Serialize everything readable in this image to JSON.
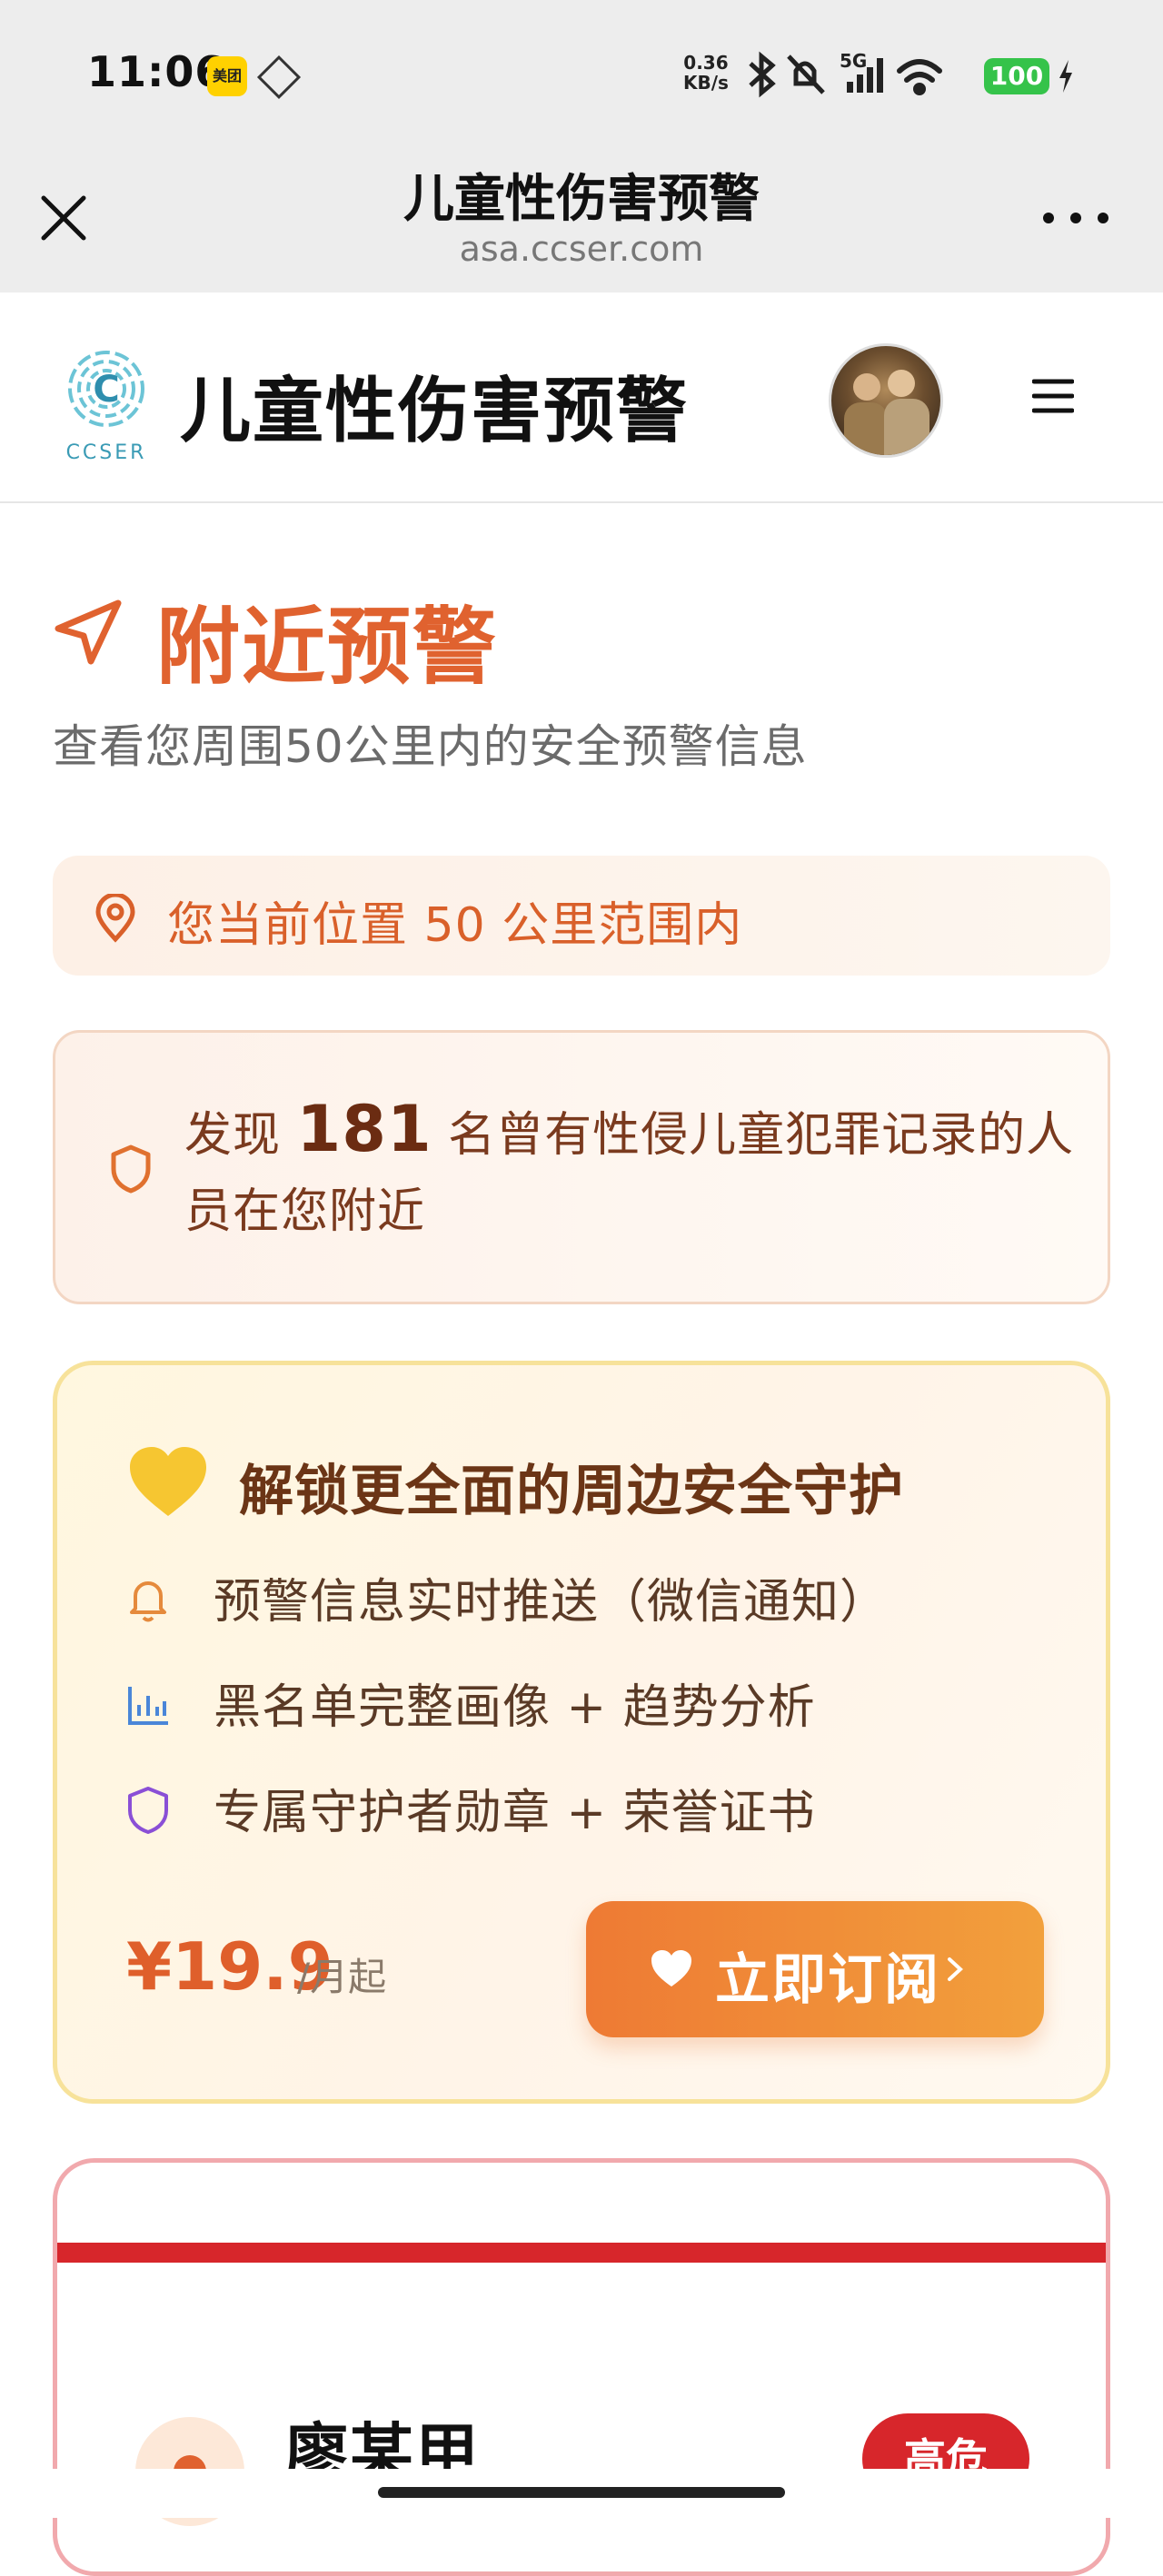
{
  "status_bar": {
    "time": "11:06",
    "app_icon_label": "美团",
    "net_speed_value": "0.36",
    "net_speed_unit": "KB/s",
    "battery": "100",
    "signal_label": "5G"
  },
  "webview": {
    "title": "儿童性伤害预警",
    "url": "asa.ccser.com"
  },
  "site_header": {
    "logo_text": "CCSER",
    "title": "儿童性伤害预警"
  },
  "nearby": {
    "title": "附近预警",
    "subtitle": "查看您周围50公里内的安全预警信息"
  },
  "location": {
    "text": "您当前位置 50 公里范围内"
  },
  "warning": {
    "prefix": "发现 ",
    "count": "181",
    "suffix": " 名曾有性侵儿童犯罪记录的人员在您附近"
  },
  "promo": {
    "title": "解锁更全面的周边安全守护",
    "features": [
      {
        "icon": "bell-icon",
        "text": "预警信息实时推送（微信通知）"
      },
      {
        "icon": "bar-chart-icon",
        "text": "黑名单完整画像 + 趋势分析"
      },
      {
        "icon": "shield-icon",
        "text": "专属守护者勋章 + 荣誉证书"
      }
    ],
    "price": "¥19.9",
    "price_unit": "/月起",
    "button_label": "立即订阅"
  },
  "person_card": {
    "name": "廖某甲",
    "badge": "高危"
  },
  "colors": {
    "accent_orange": "#e0622f",
    "danger_red": "#d7262b",
    "promo_border": "#f7e29a"
  }
}
